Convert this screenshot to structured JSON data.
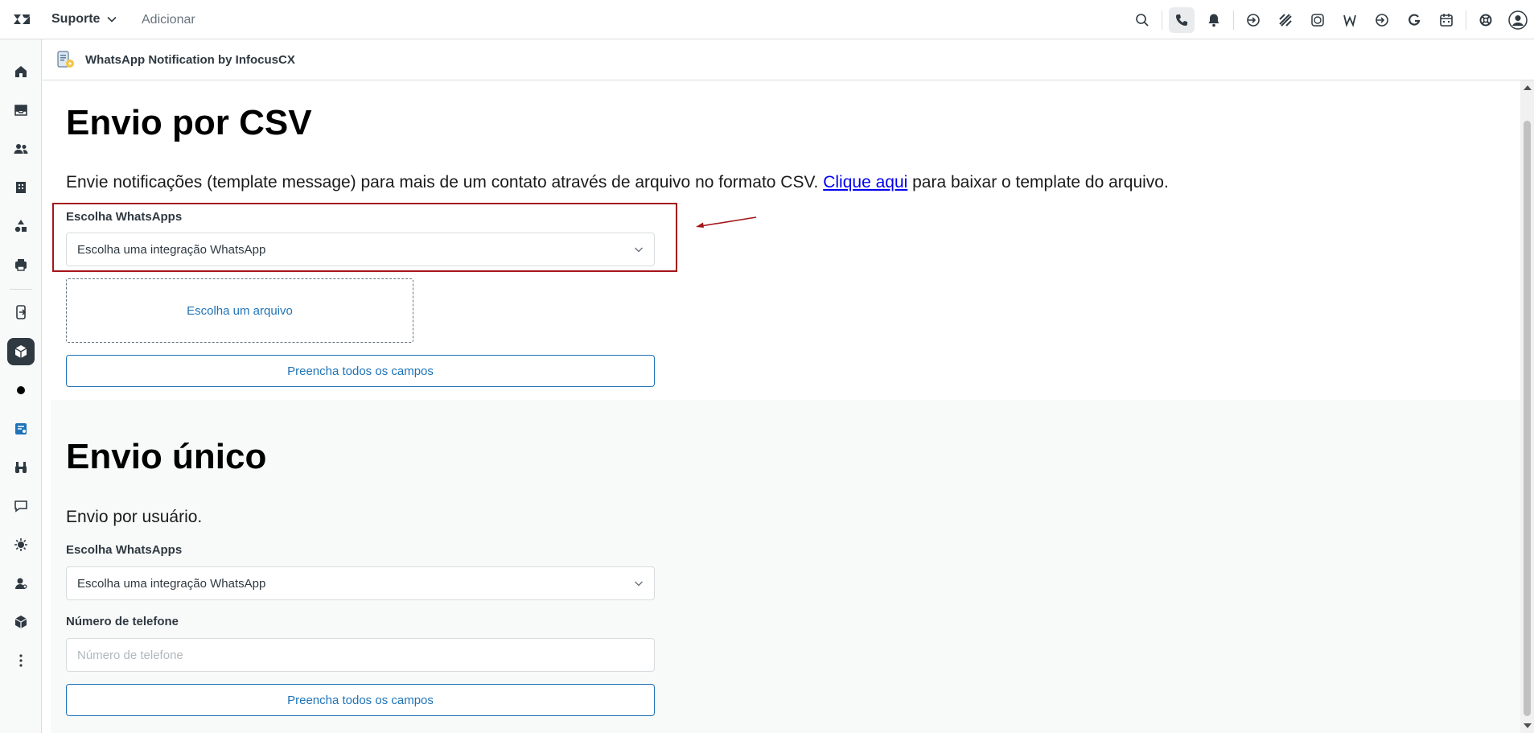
{
  "topbar": {
    "product": "Suporte",
    "add": "Adicionar"
  },
  "app": {
    "title": "WhatsApp Notification by InfocusCX"
  },
  "csv_section": {
    "heading": "Envio por CSV",
    "description_before": "Envie notificações (template message) para mais de um contato através de arquivo no formato CSV. ",
    "link_text": "Clique aqui",
    "description_after": " para baixar o template do arquivo.",
    "whatsapp_label": "Escolha WhatsApps",
    "whatsapp_select": "Escolha uma integração WhatsApp",
    "file_dropzone": "Escolha um arquivo",
    "submit": "Preencha todos os campos"
  },
  "single_section": {
    "heading": "Envio único",
    "subtitle": "Envio por usuário.",
    "whatsapp_label": "Escolha WhatsApps",
    "whatsapp_select": "Escolha uma integração WhatsApp",
    "phone_label": "Número de telefone",
    "phone_placeholder": "Número de telefone",
    "submit": "Preencha todos os campos"
  },
  "colors": {
    "accent": "#1f73b7",
    "highlight_border": "#a4151a"
  }
}
